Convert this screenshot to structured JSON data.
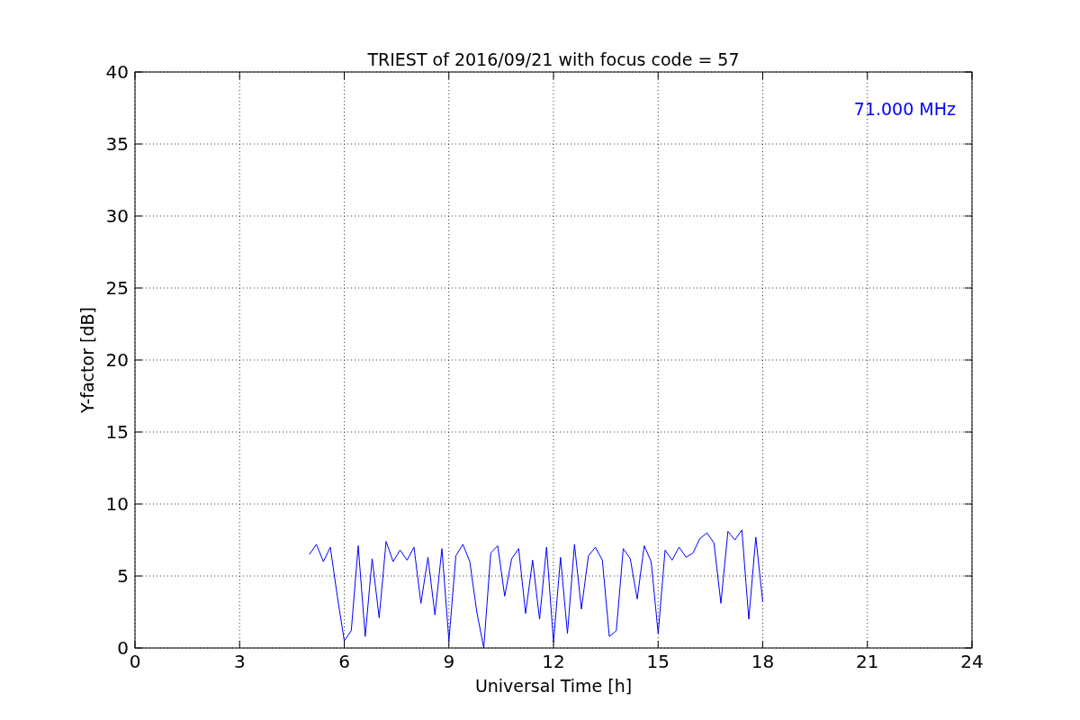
{
  "chart_data": {
    "type": "line",
    "title": "TRIEST of 2016/09/21 with focus code = 57",
    "xlabel": "Universal Time [h]",
    "ylabel": "Y-factor [dB]",
    "xlim": [
      0,
      24
    ],
    "ylim": [
      0,
      40
    ],
    "grid": true,
    "xticks": [
      0,
      3,
      6,
      9,
      12,
      15,
      18,
      21,
      24
    ],
    "yticks": [
      0,
      5,
      10,
      15,
      20,
      25,
      30,
      35,
      40
    ],
    "x": [
      5.0,
      5.2,
      5.4,
      5.6,
      5.8,
      6.0,
      6.2,
      6.4,
      6.6,
      6.8,
      7.0,
      7.2,
      7.4,
      7.6,
      7.8,
      8.0,
      8.2,
      8.4,
      8.6,
      8.8,
      9.0,
      9.2,
      9.4,
      9.6,
      9.8,
      10.0,
      10.2,
      10.4,
      10.6,
      10.8,
      11.0,
      11.2,
      11.4,
      11.6,
      11.8,
      12.0,
      12.2,
      12.4,
      12.6,
      12.8,
      13.0,
      13.2,
      13.4,
      13.6,
      13.8,
      14.0,
      14.2,
      14.4,
      14.6,
      14.8,
      15.0,
      15.2,
      15.4,
      15.6,
      15.8,
      16.0,
      16.2,
      16.4,
      16.6,
      16.8,
      17.0,
      17.2,
      17.4,
      17.6,
      17.8,
      18.0
    ],
    "series": [
      {
        "name": "71.000 MHz",
        "color": "#0000ff",
        "values": [
          6.5,
          7.2,
          6.0,
          7.0,
          3.6,
          0.5,
          1.2,
          7.1,
          0.8,
          6.2,
          2.1,
          7.4,
          6.0,
          6.8,
          6.1,
          7.0,
          3.1,
          6.3,
          2.3,
          6.9,
          0.5,
          6.4,
          7.2,
          6.0,
          2.5,
          0.0,
          6.6,
          7.1,
          3.6,
          6.2,
          6.9,
          2.4,
          6.1,
          2.0,
          7.0,
          0.4,
          6.3,
          1.0,
          7.2,
          2.7,
          6.4,
          7.0,
          6.1,
          0.8,
          1.2,
          6.9,
          6.2,
          3.4,
          7.1,
          6.0,
          1.0,
          6.8,
          6.1,
          7.0,
          6.3,
          6.6,
          7.6,
          8.0,
          7.3,
          3.1,
          8.1,
          7.5,
          8.2,
          2.0,
          7.7,
          3.2
        ]
      }
    ]
  }
}
